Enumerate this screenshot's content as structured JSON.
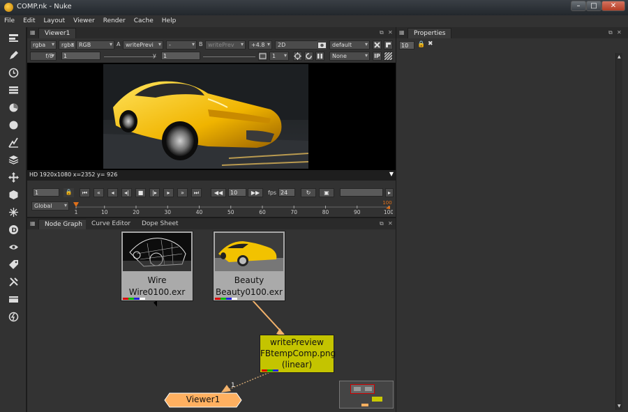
{
  "window": {
    "title": "COMP.nk - Nuke",
    "minimize": "–",
    "maximize": "□",
    "close": "✕"
  },
  "menu": [
    "File",
    "Edit",
    "Layout",
    "Viewer",
    "Render",
    "Cache",
    "Help"
  ],
  "toolbar_icons": [
    "image-icon",
    "draw-icon",
    "time-icon",
    "channel-icon",
    "color-icon",
    "filter-icon",
    "keyer-icon",
    "merge-icon",
    "transform-icon",
    "3d-icon",
    "particles-icon",
    "deep-icon",
    "views-icon",
    "metadata-icon",
    "toolsets-icon",
    "other-icon",
    "nuke-icon"
  ],
  "viewer": {
    "tab": "Viewer1",
    "channels": "rgba",
    "channels2": "rgba",
    "display": "RGB",
    "a_label": "A",
    "a_input": "writePrevi",
    "a_op": "-",
    "b_label": "B",
    "b_input": "writePrev",
    "zoom": "+4.8",
    "mode": "2D",
    "lut": "default",
    "fstop": "f/8",
    "gain": "1",
    "y_label": "y",
    "gamma": "1",
    "proxy": "1",
    "roi": "None",
    "ip": "IP",
    "info": "HD 1920x1080  x=2352 y= 926",
    "frame": "1",
    "increment": "10",
    "fps_label": "fps",
    "fps": "24",
    "range": "Global",
    "ticks": [
      "1",
      "10",
      "20",
      "30",
      "40",
      "50",
      "60",
      "70",
      "80",
      "90",
      "100"
    ],
    "end_marker": "100"
  },
  "properties": {
    "tab": "Properties",
    "max_panels": "10"
  },
  "nodegraph": {
    "tabs": [
      "Node Graph",
      "Curve Editor",
      "Dope Sheet"
    ],
    "nodes": {
      "wire": {
        "name": "Wire",
        "file": "Wire0100.exr"
      },
      "beauty": {
        "name": "Beauty",
        "file": "Beauty0100.exr"
      },
      "write": {
        "name": "writePreview",
        "file": "FBtempComp.png",
        "colorspace": "(linear)"
      },
      "viewer": {
        "name": "Viewer1",
        "input": "1"
      }
    }
  },
  "colors": {
    "ui_bg": "#323232",
    "read_node": "#aaaaaa",
    "write_node": "#c8c800",
    "viewer_node": "#ffb060",
    "pipe": "#f3b26b"
  }
}
